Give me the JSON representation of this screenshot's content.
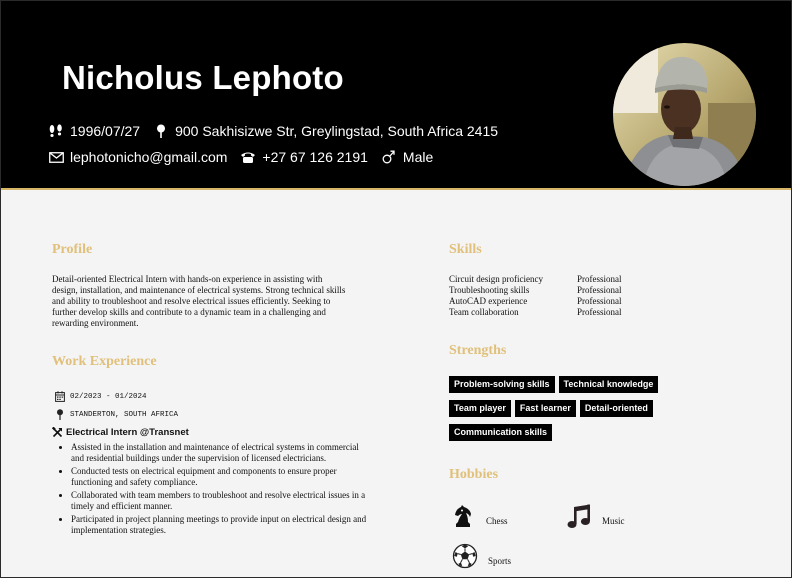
{
  "header": {
    "name": "Nicholus Lephoto",
    "birthdate": "1996/07/27",
    "address": "900 Sakhisizwe Str, Greylingstad, South Africa 2415",
    "email": "lephotonicho@gmail.com",
    "phone": "+27 67 126 2191",
    "gender": "Male",
    "icons": [
      "footprints-icon",
      "location-pin-icon",
      "envelope-icon",
      "telephone-icon",
      "male-symbol-icon"
    ]
  },
  "profile": {
    "title": "Profile",
    "text": "Detail-oriented Electrical Intern with hands-on experience in assisting with design, installation, and maintenance of electrical systems. Strong technical skills and ability to troubleshoot and resolve electrical issues efficiently. Seeking to further develop skills and contribute to a dynamic team in a challenging and rewarding environment."
  },
  "experience": {
    "title": "Work Experience",
    "date_range": "02/2023 - 01/2024",
    "location": "STANDERTON, SOUTH AFRICA",
    "job_title": "Electrical Intern @Transnet",
    "duties": [
      "Assisted in the installation and maintenance of electrical systems in commercial and residential buildings under the supervision of licensed electricians.",
      "Conducted tests on electrical equipment and components to ensure proper functioning and safety compliance.",
      "Collaborated with team members to troubleshoot and resolve electrical issues in a timely and efficient manner.",
      "Participated in project planning meetings to provide input on electrical design and implementation strategies."
    ]
  },
  "skills": {
    "title": "Skills",
    "items": [
      {
        "name": "Circuit design proficiency",
        "level": "Professional"
      },
      {
        "name": "Troubleshooting skills",
        "level": "Professional"
      },
      {
        "name": "AutoCAD experience",
        "level": "Professional"
      },
      {
        "name": "Team collaboration",
        "level": "Professional"
      }
    ]
  },
  "strengths": {
    "title": "Strengths",
    "rows": [
      [
        "Problem-solving skills",
        "Technical knowledge"
      ],
      [
        "Team player",
        "Fast learner",
        "Detail-oriented"
      ],
      [
        "Communication skills"
      ]
    ]
  },
  "hobbies": {
    "title": "Hobbies",
    "items": [
      {
        "label": "Chess",
        "icon": "chess-knight-icon"
      },
      {
        "label": "Music",
        "icon": "music-notes-icon"
      },
      {
        "label": "Sports",
        "icon": "soccer-ball-icon"
      }
    ]
  },
  "colors": {
    "header_bg": "#000000",
    "accent_gold": "#e0c07a",
    "page_bg": "#f4f4f4",
    "tag_bg": "#000000"
  }
}
